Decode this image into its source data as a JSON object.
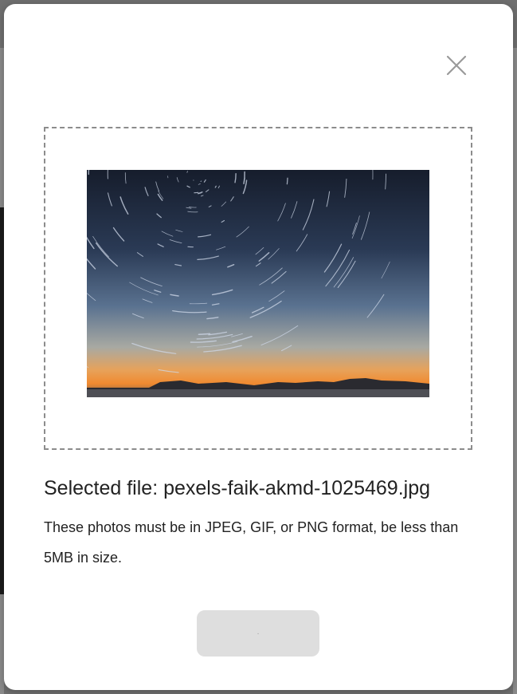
{
  "modal": {
    "close_icon": "close-icon",
    "preview": {
      "alt": "Star trails over a sunset horizon",
      "sky_top_color": "#1a2233",
      "horizon_color": "#f08a30"
    },
    "selected_file_label": "Selected file: pexels-faik-akmd-1025469.jpg",
    "hint_text": "These photos must be in JPEG, GIF, or PNG format, be less than 5MB in size.",
    "submit_label": "·"
  },
  "colors": {
    "modal_bg": "#ffffff",
    "overlay": "#6f6f6f",
    "dashed_border": "#8c8c8c",
    "button_disabled_bg": "#dedede",
    "text": "#222222"
  }
}
